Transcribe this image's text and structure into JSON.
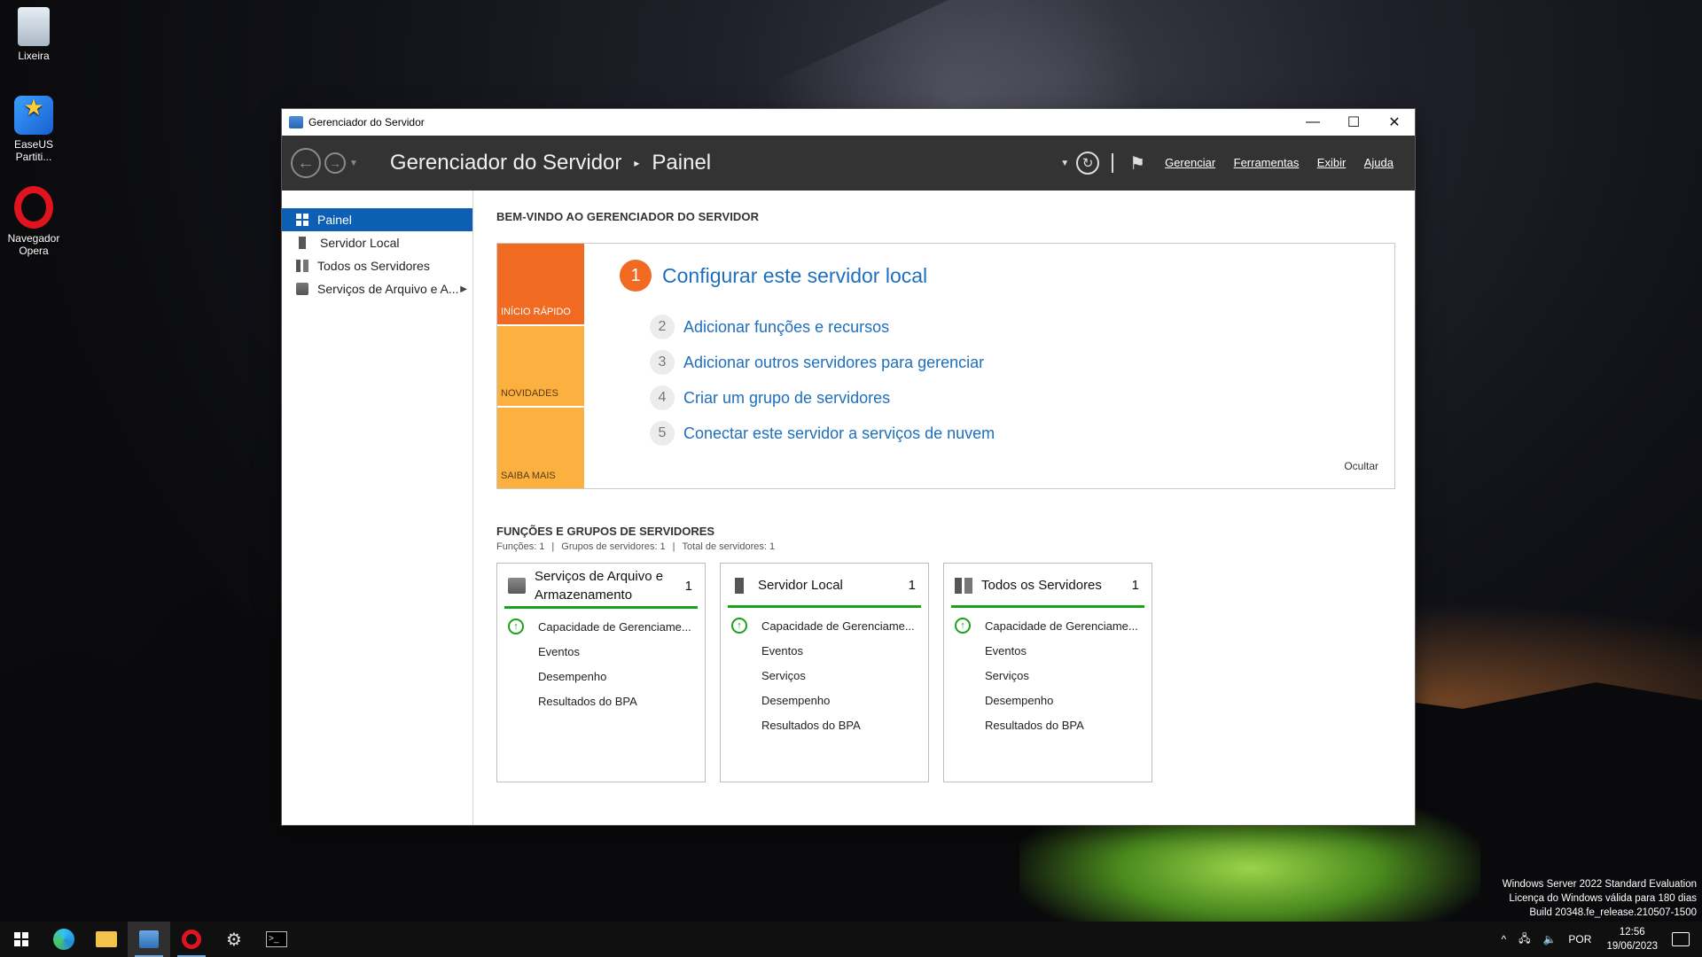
{
  "desktop": {
    "icons": [
      {
        "label": "Lixeira"
      },
      {
        "label": "EaseUS Partiti..."
      },
      {
        "label": "Navegador Opera"
      }
    ],
    "watermark": {
      "line1": "Windows Server 2022 Standard Evaluation",
      "line2": "Licença do Windows válida para 180 dias",
      "line3": "Build 20348.fe_release.210507-1500"
    }
  },
  "window": {
    "title": "Gerenciador do Servidor",
    "controls": {
      "minimize": "—",
      "maximize": "☐",
      "close": "✕"
    }
  },
  "header": {
    "breadcrumb_root": "Gerenciador do Servidor",
    "breadcrumb_sep": "▸",
    "breadcrumb_current": "Painel",
    "menu": {
      "manage": "Gerenciar",
      "tools": "Ferramentas",
      "view": "Exibir",
      "help": "Ajuda"
    }
  },
  "sidebar": {
    "items": [
      {
        "label": "Painel",
        "icon": "dashboard-icon"
      },
      {
        "label": "Servidor Local",
        "icon": "server-icon"
      },
      {
        "label": "Todos os Servidores",
        "icon": "servers-icon"
      },
      {
        "label": "Serviços de Arquivo e A...",
        "icon": "file-services-icon"
      }
    ]
  },
  "main": {
    "welcome_title": "BEM-VINDO AO GERENCIADOR DO SERVIDOR",
    "quick_start": {
      "tabs": [
        "INÍCIO RÁPIDO",
        "NOVIDADES",
        "SAIBA MAIS"
      ],
      "primary": {
        "num": "1",
        "text": "Configurar este servidor local"
      },
      "steps": [
        {
          "num": "2",
          "text": "Adicionar funções e recursos"
        },
        {
          "num": "3",
          "text": "Adicionar outros servidores para gerenciar"
        },
        {
          "num": "4",
          "text": "Criar um grupo de servidores"
        },
        {
          "num": "5",
          "text": "Conectar este servidor a serviços de nuvem"
        }
      ],
      "hide": "Ocultar"
    },
    "roles": {
      "title": "FUNÇÕES E GRUPOS DE SERVIDORES",
      "roles_count": "Funções: 1",
      "groups_count": "Grupos de servidores: 1",
      "total_count": "Total de servidores: 1",
      "tiles": [
        {
          "name": "Serviços de Arquivo e Armazenamento",
          "count": "1",
          "rows": [
            "Capacidade de Gerenciame...",
            "Eventos",
            "Desempenho",
            "Resultados do BPA"
          ]
        },
        {
          "name": "Servidor Local",
          "count": "1",
          "rows": [
            "Capacidade de Gerenciame...",
            "Eventos",
            "Serviços",
            "Desempenho",
            "Resultados do BPA"
          ]
        },
        {
          "name": "Todos os Servidores",
          "count": "1",
          "rows": [
            "Capacidade de Gerenciame...",
            "Eventos",
            "Serviços",
            "Desempenho",
            "Resultados do BPA"
          ]
        }
      ]
    }
  },
  "taskbar": {
    "lang": "POR",
    "time": "12:56",
    "date": "19/06/2023"
  }
}
